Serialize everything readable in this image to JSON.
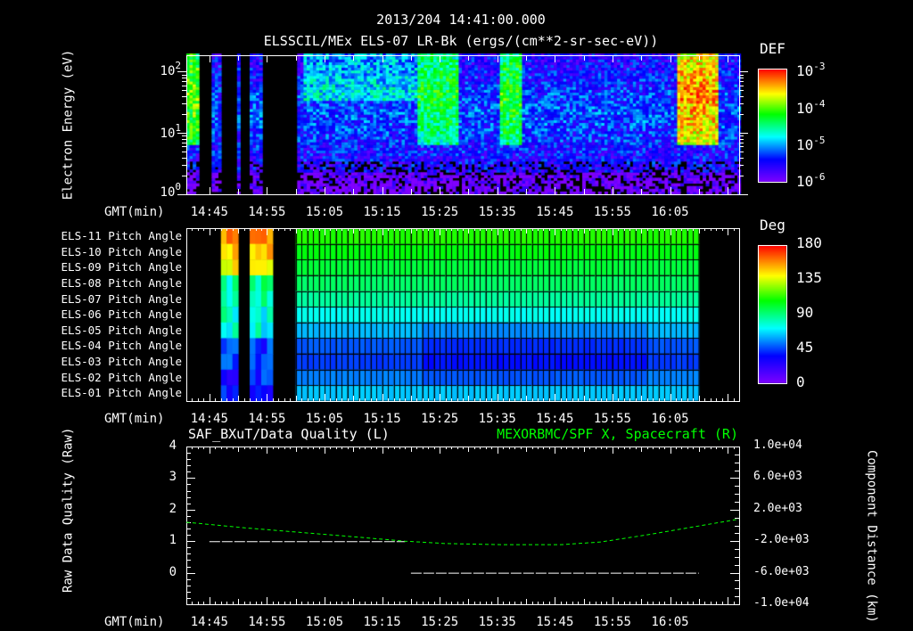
{
  "header": {
    "title": "2013/204 14:41:00.000",
    "subtitle": "ELSSCIL/MEx ELS-07 LR-Bk  (ergs/(cm**2-sr-sec-eV))"
  },
  "time_axis": {
    "label": "GMT(min)",
    "range_min": [
      "14:41",
      "16:17"
    ],
    "ticks": [
      "14:45",
      "14:55",
      "15:05",
      "15:15",
      "15:25",
      "15:35",
      "15:45",
      "15:55",
      "16:05"
    ]
  },
  "chart_data": [
    {
      "type": "heatmap",
      "title": "ELSSCIL/MEx ELS-07 LR-Bk",
      "ylabel": "Electron Energy (eV)",
      "yscale": "log",
      "ylim": [
        1,
        185
      ],
      "ytick_labels": [
        {
          "base": "10",
          "exp": "2"
        },
        {
          "base": "10",
          "exp": "1"
        },
        {
          "base": "10",
          "exp": "0"
        }
      ],
      "colorbar": {
        "title": "DEF",
        "scale": "log",
        "range": [
          1e-06,
          0.001
        ],
        "tick_labels": [
          {
            "base": "10",
            "exp": "-3"
          },
          {
            "base": "10",
            "exp": "-4"
          },
          {
            "base": "10",
            "exp": "-5"
          },
          {
            "base": "10",
            "exp": "-6"
          }
        ]
      },
      "data_gaps_min": [
        [
          14.62,
          14.9
        ],
        [
          15.04,
          15.3
        ],
        [
          15.4,
          15.55
        ],
        [
          16.25,
          16.5
        ],
        [
          16.5,
          17.0
        ]
      ],
      "features": [
        {
          "start": "14:41",
          "end": "14:43",
          "level_log": -4.0
        },
        {
          "start": "15:22",
          "end": "15:27",
          "level_log": -4.3
        },
        {
          "start": "15:36",
          "end": "15:38",
          "level_log": -4.2
        },
        {
          "start": "16:07",
          "end": "16:12",
          "level_log": -3.4
        }
      ]
    },
    {
      "type": "heatmap",
      "ylabel": "Pitch Angle",
      "rows": [
        "ELS-11 Pitch Angle",
        "ELS-10 Pitch Angle",
        "ELS-09 Pitch Angle",
        "ELS-08 Pitch Angle",
        "ELS-07 Pitch Angle",
        "ELS-06 Pitch Angle",
        "ELS-05 Pitch Angle",
        "ELS-04 Pitch Angle",
        "ELS-03 Pitch Angle",
        "ELS-02 Pitch Angle",
        "ELS-01 Pitch Angle"
      ],
      "pitch_angles_deg": [
        112,
        106,
        100,
        94,
        86,
        74,
        62,
        48,
        44,
        54,
        64
      ],
      "data_intervals": [
        [
          "14:47",
          "14:50"
        ],
        [
          "14:52",
          "14:56"
        ],
        [
          "15:00",
          "16:10"
        ]
      ],
      "colorbar": {
        "title": "Deg",
        "range": [
          0,
          180
        ],
        "tick_labels": [
          "180",
          "135",
          "90",
          "45",
          "0"
        ]
      }
    },
    {
      "type": "line",
      "title_left": "SAF_BXuT/Data Quality (L)",
      "title_right": "MEXORBMC/SPF X, Spacecraft (R)",
      "ylabel_left": "Raw Data Quality (Raw)",
      "ylabel_right": "Component Distance (km)",
      "ylim_left": [
        -1,
        4
      ],
      "yticks_left": [
        "4",
        "3",
        "2",
        "1",
        "0"
      ],
      "ylim_right": [
        -10000,
        10000
      ],
      "yticks_right": [
        "1.0e+04",
        "6.0e+03",
        "2.0e+03",
        "-2.0e+03",
        "-6.0e+03",
        "-1.0e+04"
      ],
      "series": [
        {
          "name": "Data Quality",
          "axis": "left",
          "color": "#ffffff",
          "segments": [
            {
              "start_min": 4,
              "end_min": 38,
              "value": 1
            },
            {
              "start_min": 39,
              "end_min": 89,
              "value": 0
            }
          ]
        },
        {
          "name": "Spacecraft X",
          "axis": "right",
          "color": "#00ff00",
          "style": "dashed",
          "x_min": [
            0,
            10,
            20,
            30,
            38,
            45,
            55,
            65,
            72,
            80,
            88,
            96
          ],
          "values": [
            400,
            -300,
            -900,
            -1500,
            -2000,
            -2300,
            -2450,
            -2450,
            -2100,
            -1200,
            -200,
            800
          ]
        }
      ]
    }
  ]
}
